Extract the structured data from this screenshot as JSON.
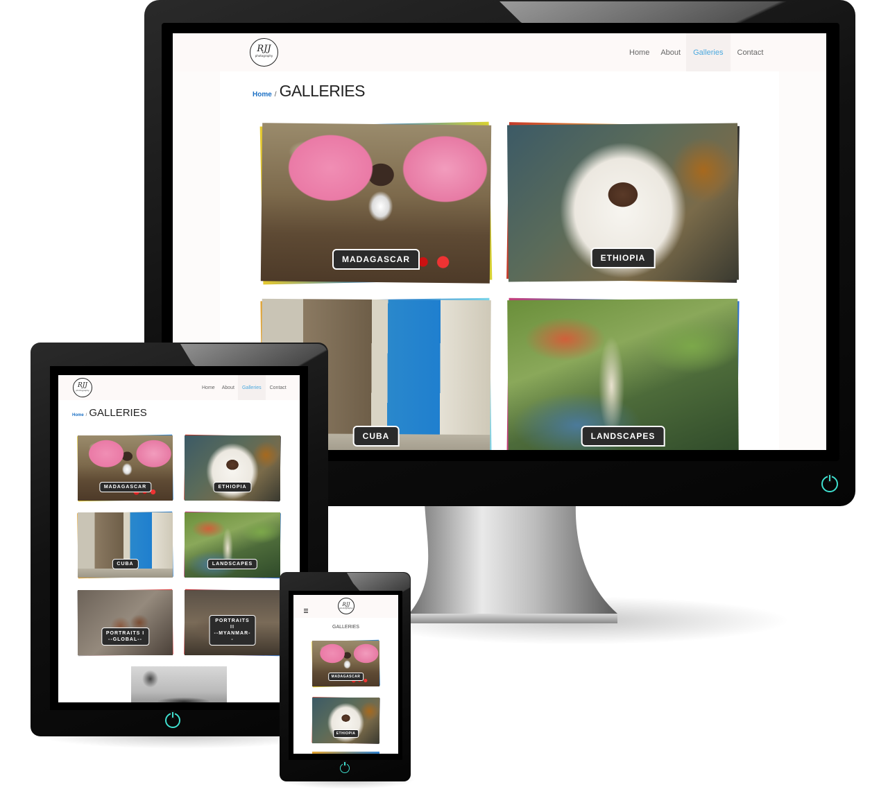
{
  "site": {
    "logo_monogram": "RJJ",
    "logo_subtitle": "photography",
    "nav": [
      "Home",
      "About",
      "Galleries",
      "Contact"
    ],
    "active_nav": "Galleries",
    "breadcrumb_home": "Home",
    "breadcrumb_separator": "/",
    "page_title": "GALLERIES"
  },
  "galleries": [
    "MADAGASCAR",
    "ETHIOPIA",
    "CUBA",
    "LANDSCAPES",
    "PORTRAITS I --GLOBAL--",
    "PORTRAITS II --MYANMAR--"
  ],
  "portraits1": {
    "line1": "PORTRAITS I",
    "line2": "--GLOBAL--"
  },
  "portraits2": {
    "line1": "PORTRAITS",
    "line2": "II",
    "line3": "--MYANMAR-",
    "line4": "-"
  },
  "mobile": {
    "menu_icon": "hamburger-icon",
    "title": "GALLERIES"
  },
  "colors": {
    "accent": "#4aa8de",
    "link": "#1a6fc4",
    "power": "#3fe0cf",
    "label_bg": "#2b2b2b"
  },
  "icons": [
    "power-icon",
    "hamburger-icon"
  ]
}
